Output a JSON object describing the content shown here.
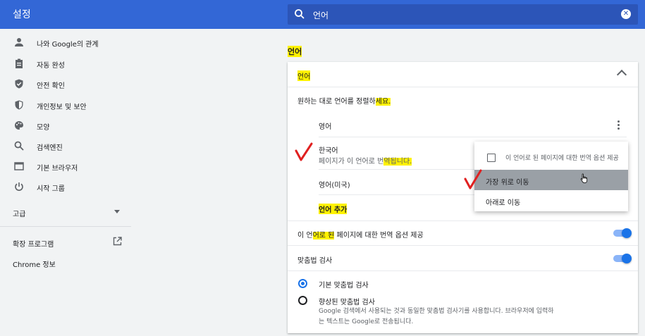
{
  "header": {
    "title": "설정",
    "search_value": "언어"
  },
  "sidebar": {
    "items": [
      {
        "label": "나와 Google의 관계",
        "icon": "person-icon"
      },
      {
        "label": "자동 완성",
        "icon": "clipboard-icon"
      },
      {
        "label": "안전 확인",
        "icon": "shield-check-icon"
      },
      {
        "label": "개인정보 및 보안",
        "icon": "shield-icon"
      },
      {
        "label": "모양",
        "icon": "palette-icon"
      },
      {
        "label": "검색엔진",
        "icon": "search-icon"
      },
      {
        "label": "기본 브라우저",
        "icon": "browser-icon"
      },
      {
        "label": "시작 그룹",
        "icon": "power-icon"
      }
    ],
    "advanced": "고급",
    "extensions": "확장 프로그램",
    "about": "Chrome 정보"
  },
  "main": {
    "section_title": "언어",
    "card": {
      "header": "언어",
      "order_hint_prefix": "원하는 대로 언어를 정렬하",
      "order_hint_hl": "세요.",
      "languages": [
        {
          "name": "영어"
        },
        {
          "name": "한국어",
          "note_prefix": "페이지가 이 언어로 번",
          "note_hl": "역됩니다."
        },
        {
          "name": "영어(미국)"
        }
      ],
      "add_language": "언어 추가",
      "translate_prefix": "이 언",
      "translate_hl": "어로 된",
      "translate_suffix": " 페이지에 대한 번역 옵션 제공",
      "spellcheck": "맞춤법 검사",
      "basic_spell": "기본 맞춤법 검사",
      "enhanced_spell": "향상된 맞춤법 검사",
      "enhanced_desc1": "Google 검색에서 사용되는 것과 동일한 맞춤법 검사기를 사용합니다. 브라우저에 입력하",
      "enhanced_desc2": "는 텍스트는 Google로 전송됩니다."
    }
  },
  "menu": {
    "offer_translate": "이 언어로 된 페이지에 대한 번역 옵션 제공",
    "move_top": "가장 위로 이동",
    "move_down": "아래로 이동"
  },
  "colors": {
    "header": "#3367d6",
    "accent": "#1a73e8",
    "highlight": "#fff200",
    "annotation": "#e02020"
  }
}
